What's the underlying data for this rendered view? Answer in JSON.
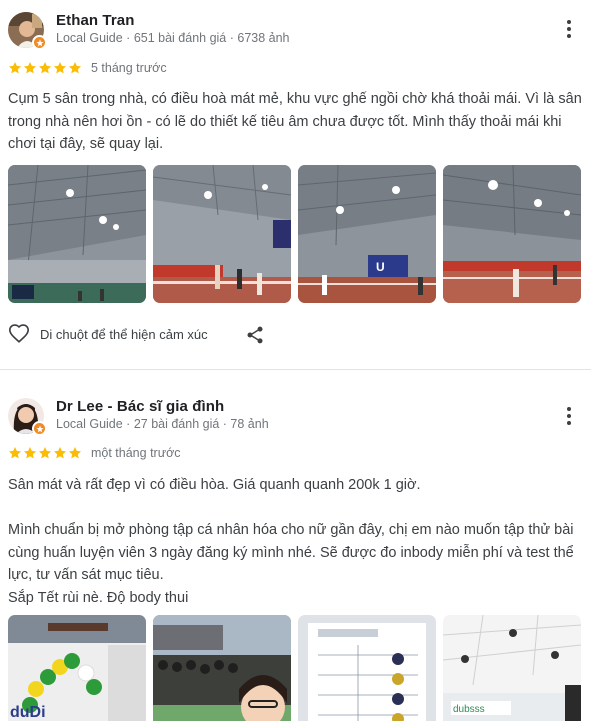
{
  "reviews": [
    {
      "author": "Ethan Tran",
      "meta": "Local Guide · 651 bài đánh giá · 6738 ảnh",
      "rating": 5,
      "when": "5 tháng trước",
      "text": "Cụm 5 sân trong nhà, có điều hoà mát mẻ, khu vực ghế ngồi chờ khá thoải mái. Vì là sân trong nhà nên hơi ồn - có lẽ do thiết kế tiêu âm chưa được tốt. Mình thấy thoải mái khi chơi tại đây, sẽ quay lại.",
      "photo_count": 4,
      "react_label": "Di chuột để thể hiện cảm xúc"
    },
    {
      "author": "Dr Lee - Bác sĩ gia đình",
      "meta": "Local Guide · 27 bài đánh giá · 78 ảnh",
      "rating": 5,
      "when": "một tháng trước",
      "text": "Sân mát và rất đẹp vì có điều hòa. Giá quanh quanh 200k 1 giờ.\n\nMình chuẩn bị mở phòng tập cá nhân hóa cho nữ gần đây, chị em nào muốn tập thử bài cùng huấn luyện viên 3 ngày đăng ký mình nhé. Sẽ được đo inbody miễn phí và test thể lực, tư vấn sát mục tiêu.\nSắp Tết rùi nè. Độ body thui",
      "photo_count": 4
    }
  ],
  "colors": {
    "star": "#fbbc04",
    "badge": "#f08a24",
    "meta_text": "#70757a",
    "body_text": "#3c4043"
  },
  "icons": {
    "more": "more-vert-icon",
    "heart": "heart-outline-icon",
    "share": "share-icon",
    "star": "star-icon",
    "badge": "local-guide-badge-icon"
  }
}
